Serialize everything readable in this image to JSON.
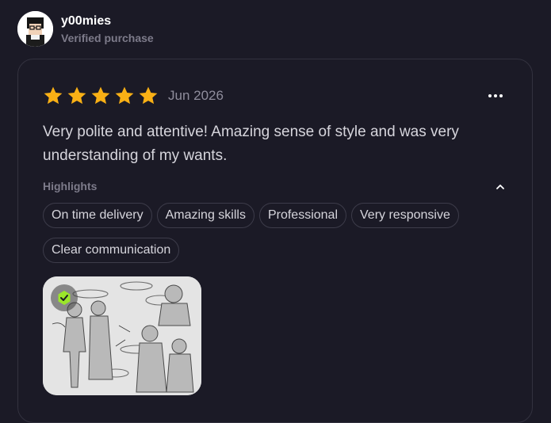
{
  "user": {
    "name": "y00mies",
    "status": "Verified purchase"
  },
  "review": {
    "rating": 5,
    "max_rating": 5,
    "date": "Jun 2026",
    "text": "Very polite and attentive! Amazing sense of style and was very understanding of my wants.",
    "highlights_label": "Highlights",
    "highlights": [
      "On time delivery",
      "Amazing skills",
      "Professional",
      "Very responsive",
      "Clear communication"
    ]
  },
  "icons": {
    "more": "more-horizontal-icon",
    "collapse": "chevron-up-icon",
    "badge": "verified-check-icon",
    "star": "star-icon"
  },
  "colors": {
    "background": "#1b1a26",
    "star": "#f9b015",
    "badge": "#9be62a",
    "border": "#33323f"
  }
}
